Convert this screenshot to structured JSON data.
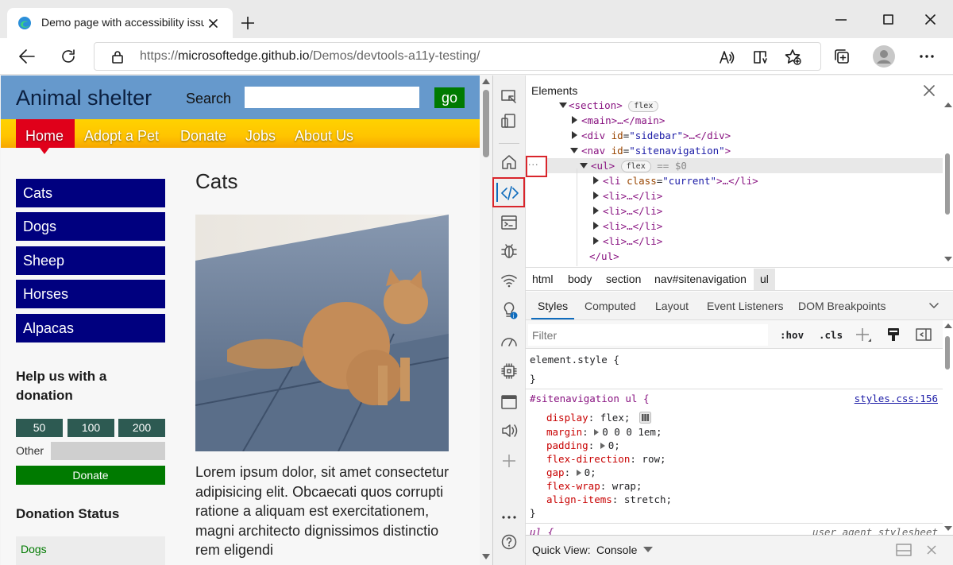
{
  "browser": {
    "tab_title": "Demo page with accessibility issues",
    "url_prefix": "https://",
    "url_domain": "microsoftedge.github.io",
    "url_path": "/Demos/devtools-a11y-testing/"
  },
  "page": {
    "site_title": "Animal shelter",
    "search_label": "Search",
    "search_value": "",
    "go_label": "go",
    "menu": [
      "Home",
      "Adopt a Pet",
      "Donate",
      "Jobs",
      "About Us"
    ],
    "sidebar_links": [
      "Cats",
      "Dogs",
      "Sheep",
      "Horses",
      "Alpacas"
    ],
    "donation_heading": "Help us with a donation",
    "amounts": [
      "50",
      "100",
      "200"
    ],
    "other_label": "Other",
    "other_value": "",
    "donate_label": "Donate",
    "status_heading": "Donation Status",
    "status_first": "Dogs",
    "main_heading": "Cats",
    "lorem": "Lorem ipsum dolor, sit amet consectetur adipisicing elit. Obcaecati quos corrupti ratione a aliquam est exercitationem, magni architecto dignissimos distinctio rem eligendi"
  },
  "devtools": {
    "panel_title": "Elements",
    "dom": {
      "section_tag": "<section>",
      "flex_badge": "flex",
      "main_line": "<main>…</main>",
      "div_open": "<div ",
      "div_attr": "id",
      "div_val": "\"sidebar\"",
      "div_close": ">…</div>",
      "nav_open": "<nav ",
      "nav_attr": "id",
      "nav_val": "\"sitenavigation\"",
      "nav_close": ">",
      "ul_tag": "<ul>",
      "ul_suffix": "== $0",
      "li_open": "<li ",
      "li_attr": "class",
      "li_val": "\"current\"",
      "li_close": ">…</li>",
      "li_collapsed": "<li>…</li>",
      "ul_end": "</ul>",
      "ellipsis": "···"
    },
    "breadcrumbs": [
      "html",
      "body",
      "section",
      "nav#sitenavigation",
      "ul"
    ],
    "style_tabs": [
      "Styles",
      "Computed",
      "Layout",
      "Event Listeners",
      "DOM Breakpoints"
    ],
    "filter_placeholder": "Filter",
    "hov": ":hov",
    "cls": ".cls",
    "element_style": "element.style {",
    "close_brace": "}",
    "rule_selector": "#sitenavigation ul {",
    "rule_source": "styles.css:156",
    "declarations": [
      {
        "name": "display",
        "value": "flex;"
      },
      {
        "name": "margin",
        "value": "0 0 0 1em;"
      },
      {
        "name": "padding",
        "value": "0;"
      },
      {
        "name": "flex-direction",
        "value": "row;"
      },
      {
        "name": "gap",
        "value": "0;"
      },
      {
        "name": "flex-wrap",
        "value": "wrap;"
      },
      {
        "name": "align-items",
        "value": "stretch;"
      }
    ],
    "ua_selector": "ul {",
    "ua_source": "user agent stylesheet",
    "quick_view_label": "Quick View:",
    "quick_view_value": "Console"
  },
  "colors": {
    "accent": "#0f6cbd",
    "highlight_red": "#d9262c",
    "page_header": "#6699cc",
    "nav_link": "#00007f"
  }
}
